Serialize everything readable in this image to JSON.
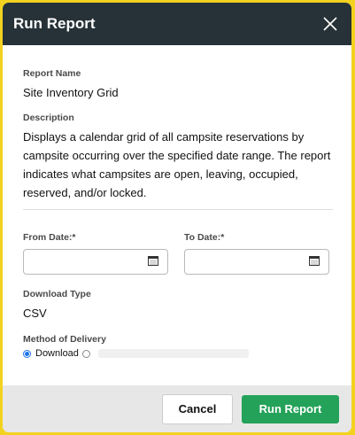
{
  "dialog": {
    "title": "Run Report",
    "report_name_label": "Report Name",
    "report_name": "Site Inventory Grid",
    "description_label": "Description",
    "description": "Displays a calendar grid of all campsite reservations by campsite occurring over the specified date range. The report indicates what campsites are open, leaving, occupied, reserved, and/or locked.",
    "from_date_label": "From Date:*",
    "from_date_value": "",
    "to_date_label": "To Date:*",
    "to_date_value": "",
    "download_type_label": "Download Type",
    "download_type": "CSV",
    "method_label": "Method of Delivery",
    "methods": [
      {
        "label": "Download",
        "selected": true
      },
      {
        "label": "",
        "selected": false
      }
    ],
    "cancel_label": "Cancel",
    "run_label": "Run Report"
  },
  "colors": {
    "frame_border": "#f3d21f",
    "header_bg": "#263238",
    "run_button": "#25a25a",
    "radio_selected": "#1a73e8"
  }
}
